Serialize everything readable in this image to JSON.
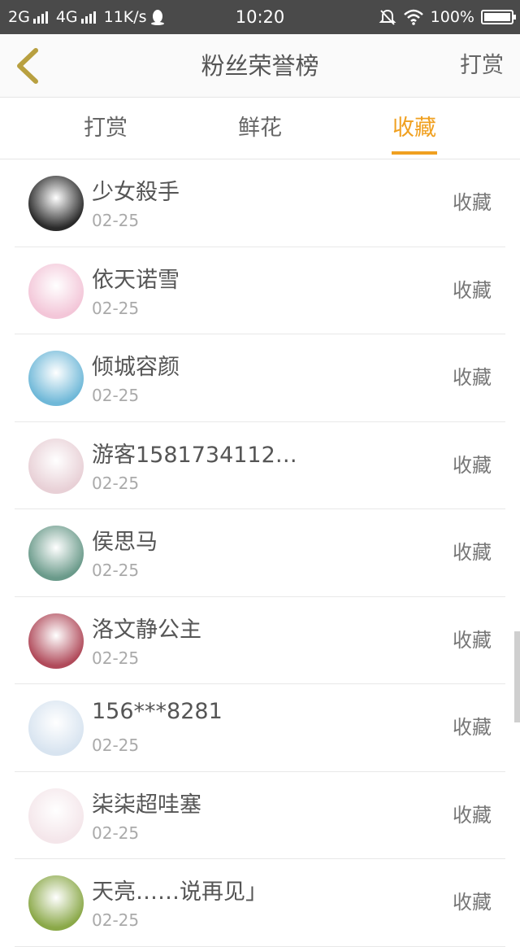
{
  "status_bar": {
    "left": [
      "2G",
      "4G",
      "11K/s"
    ],
    "time": "10:20",
    "battery": "100%",
    "icons": [
      "signal-icon",
      "qq-penguin-icon",
      "mute-bell-icon",
      "wifi-icon",
      "battery-icon"
    ]
  },
  "header": {
    "title": "粉丝荣誉榜",
    "action": "打赏",
    "back_icon": "chevron-left-icon",
    "accent_color": "#f0a020"
  },
  "tabs": [
    {
      "label": "打赏"
    },
    {
      "label": "鲜花"
    },
    {
      "label": "收藏",
      "active": true
    }
  ],
  "fans": [
    {
      "name": "少女殺手",
      "date": "02-25",
      "action": "收藏",
      "avatar_color": "#2a2a2a"
    },
    {
      "name": "依天诺雪",
      "date": "02-25",
      "action": "收藏",
      "avatar_color": "#f3c6d8"
    },
    {
      "name": "倾城容颜",
      "date": "02-25",
      "action": "收藏",
      "avatar_color": "#6fb8d8"
    },
    {
      "name": "游客1581734112…",
      "date": "02-25",
      "action": "收藏",
      "avatar_color": "#e8d0d6"
    },
    {
      "name": "侯思马",
      "date": "02-25",
      "action": "收藏",
      "avatar_color": "#6a9a8a"
    },
    {
      "name": "洛文静公主",
      "date": "02-25",
      "action": "收藏",
      "avatar_color": "#b04a5a"
    },
    {
      "name": "156***8281",
      "date": "02-25",
      "action": "收藏",
      "avatar_color": "#d8e4f0"
    },
    {
      "name": "柒柒超哇塞",
      "date": "02-25",
      "action": "收藏",
      "avatar_color": "#f4e6ea"
    },
    {
      "name": "天亮……说再见」",
      "date": "02-25",
      "action": "收藏",
      "avatar_color": "#8aa848"
    }
  ]
}
